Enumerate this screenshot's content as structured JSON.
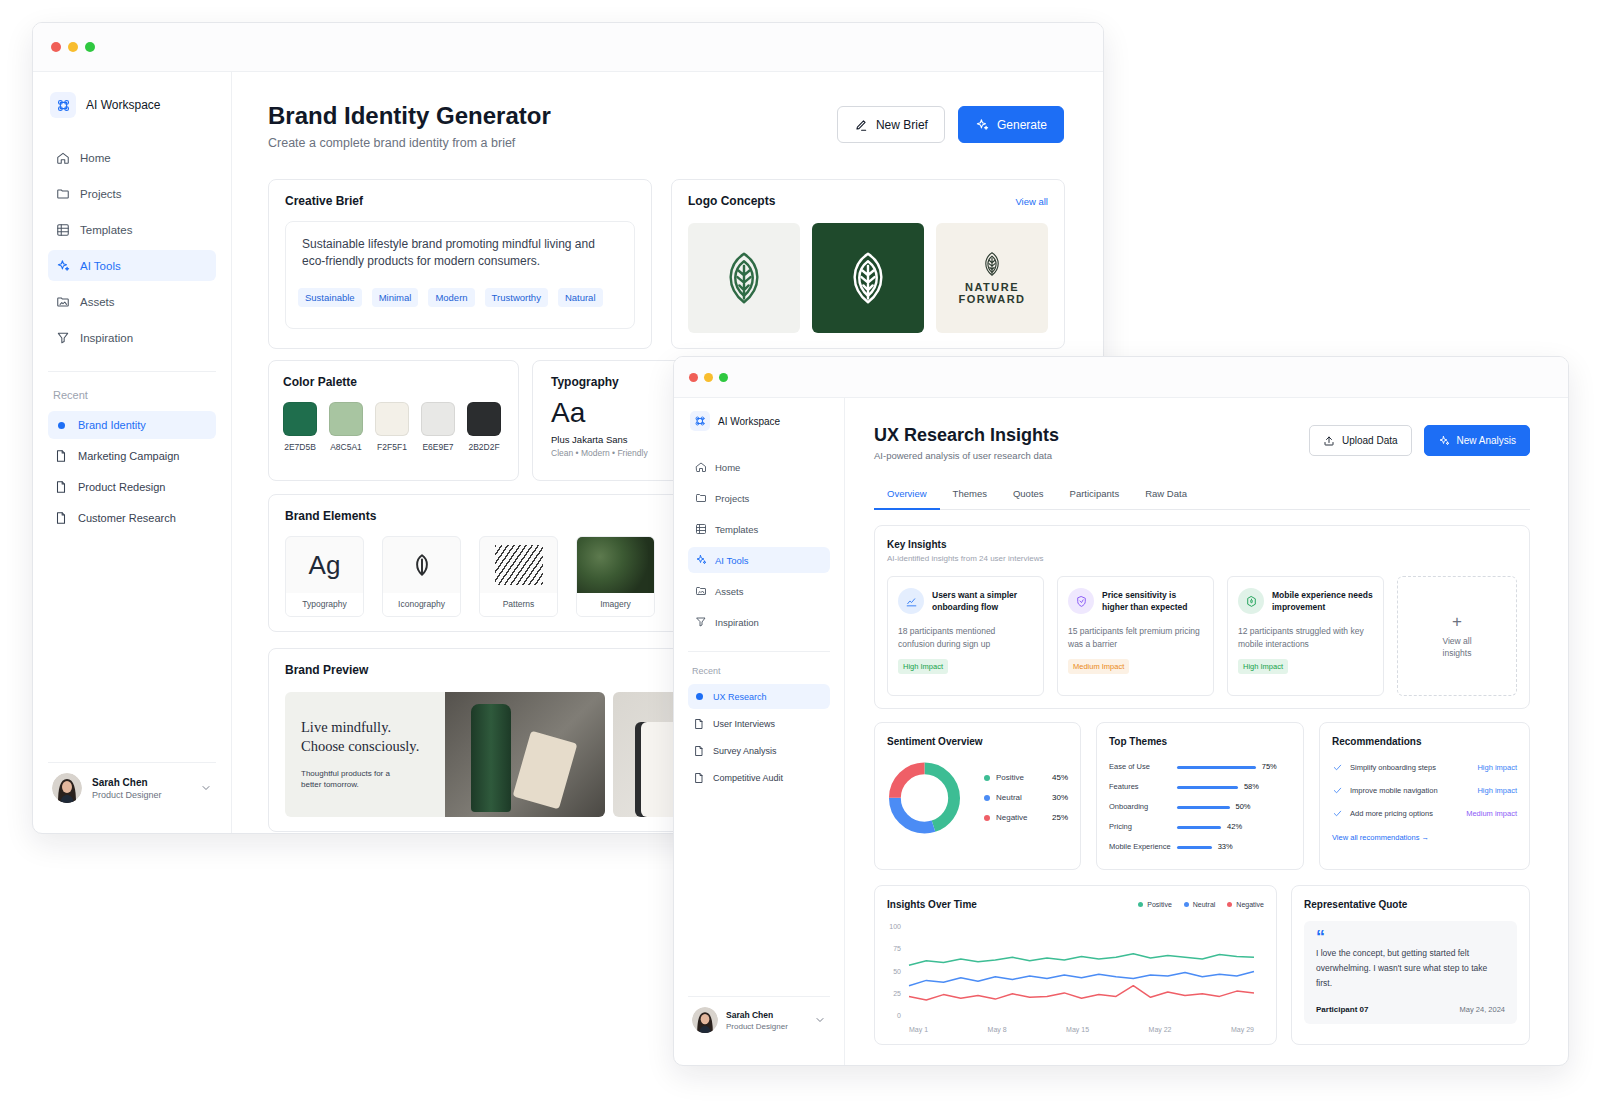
{
  "brand_window": {
    "sidebar": {
      "workspace": "AI Workspace",
      "nav": [
        {
          "label": "Home",
          "selected": false
        },
        {
          "label": "Projects",
          "selected": false
        },
        {
          "label": "Templates",
          "selected": false
        },
        {
          "label": "AI Tools",
          "selected": true
        },
        {
          "label": "Assets",
          "selected": false
        },
        {
          "label": "Inspiration",
          "selected": false
        }
      ],
      "recent_heading": "Recent",
      "recent": [
        {
          "label": "Brand Identity",
          "selected": true
        },
        {
          "label": "Marketing Campaign",
          "selected": false
        },
        {
          "label": "Product Redesign",
          "selected": false
        },
        {
          "label": "Customer Research",
          "selected": false
        }
      ],
      "user": {
        "name": "Sarah Chen",
        "role": "Product Designer"
      }
    },
    "header": {
      "title": "Brand Identity Generator",
      "subtitle": "Create a complete brand identity from a brief",
      "buttons": [
        {
          "label": "New Brief",
          "kind": "secondary"
        },
        {
          "label": "Generate",
          "kind": "primary"
        }
      ]
    },
    "creative_brief": {
      "title": "Creative Brief",
      "text": "Sustainable lifestyle brand promoting mindful living and eco-friendly products for modern consumers.",
      "tags": [
        "Sustainable",
        "Minimal",
        "Modern",
        "Trustworthy",
        "Natural"
      ]
    },
    "logo_concepts": {
      "title": "Logo Concepts",
      "link": "View all",
      "concepts": [
        {
          "kind": "mark",
          "color": "#f1f2ef",
          "ink": "#2f6b45"
        },
        {
          "kind": "mark",
          "color": "#1f4a2c",
          "ink": "#ffffff"
        },
        {
          "kind": "wordmark",
          "color": "#f4f1ea",
          "ink": "#2b3a2f",
          "lines": [
            "NATURE",
            "FORWARD"
          ]
        }
      ]
    },
    "color_palette": {
      "title": "Color Palette",
      "swatches": [
        {
          "label": "2E7D5B",
          "color": "#1f6e4d"
        },
        {
          "label": "A8C5A1",
          "color": "#a8c5a1"
        },
        {
          "label": "F2F5F1",
          "color": "#f3f0e8"
        },
        {
          "label": "E6E9E7",
          "color": "#e8e8e6"
        },
        {
          "label": "2B2D2F",
          "color": "#2b2d2f"
        }
      ]
    },
    "typography": {
      "title": "Typography",
      "sample": "Aa",
      "font": "Plus Jakarta Sans",
      "traits": "Clean • Modern • Friendly"
    },
    "brand_elements": {
      "title": "Brand Elements",
      "items": [
        {
          "kind": "type",
          "glyph": "Ag",
          "label": "Typography"
        },
        {
          "kind": "icon",
          "label": "Iconography"
        },
        {
          "kind": "pattern",
          "label": "Patterns"
        },
        {
          "kind": "image",
          "label": "Imagery"
        }
      ]
    },
    "brand_preview": {
      "title": "Brand Preview",
      "headline": [
        "Live mindfully.",
        "Choose consciously."
      ],
      "body": "Thoughtful products for a better tomorrow."
    }
  },
  "research_window": {
    "sidebar": {
      "workspace": "AI Workspace",
      "nav": [
        {
          "label": "Home",
          "selected": false
        },
        {
          "label": "Projects",
          "selected": false
        },
        {
          "label": "Templates",
          "selected": false
        },
        {
          "label": "AI Tools",
          "selected": true
        },
        {
          "label": "Assets",
          "selected": false
        },
        {
          "label": "Inspiration",
          "selected": false
        }
      ],
      "recent_heading": "Recent",
      "recent": [
        {
          "label": "UX Research",
          "selected": true
        },
        {
          "label": "User Interviews",
          "selected": false
        },
        {
          "label": "Survey Analysis",
          "selected": false
        },
        {
          "label": "Competitive Audit",
          "selected": false
        }
      ],
      "user": {
        "name": "Sarah Chen",
        "role": "Product Designer"
      }
    },
    "header": {
      "title": "UX Research Insights",
      "subtitle": "AI-powered analysis of user research data",
      "buttons": [
        {
          "label": "Upload Data",
          "kind": "secondary"
        },
        {
          "label": "New Analysis",
          "kind": "primary"
        }
      ]
    },
    "tabs": [
      {
        "label": "Overview",
        "selected": true
      },
      {
        "label": "Themes",
        "selected": false
      },
      {
        "label": "Quotes",
        "selected": false
      },
      {
        "label": "Participants",
        "selected": false
      },
      {
        "label": "Raw Data",
        "selected": false
      }
    ],
    "key_insights": {
      "title": "Key Insights",
      "subtitle": "AI-identified insights from 24 user interviews",
      "insights": [
        {
          "title": "Users want a simpler onboarding flow",
          "detail": "18 participants mentioned confusion during sign up",
          "impact": "High Impact",
          "color": "#3b82f6",
          "impact_color": "#16a34a"
        },
        {
          "title": "Price sensitivity is higher than expected",
          "detail": "15 participants felt premium pricing was a barrier",
          "impact": "Medium Impact",
          "color": "#8b5cf6",
          "impact_color": "#ea8a1a"
        },
        {
          "title": "Mobile experience needs improvement",
          "detail": "12 participants struggled with key mobile interactions",
          "impact": "High Impact",
          "color": "#22a35a",
          "impact_color": "#16a34a"
        }
      ],
      "add": {
        "icon": "+",
        "label": "View all insights"
      }
    },
    "sentiment": {
      "title": "Sentiment Overview",
      "segments": [
        {
          "label": "Positive",
          "value": "45%",
          "share": 0.45,
          "color": "#3dbd94"
        },
        {
          "label": "Neutral",
          "value": "30%",
          "share": 0.3,
          "color": "#4b8cf5"
        },
        {
          "label": "Negative",
          "value": "25%",
          "share": 0.25,
          "color": "#ef5f67"
        }
      ]
    },
    "top_themes": {
      "title": "Top Themes",
      "themes": [
        {
          "label": "Ease of Use",
          "value": "75%",
          "level": 0.75
        },
        {
          "label": "Features",
          "value": "58%",
          "level": 0.58
        },
        {
          "label": "Onboarding",
          "value": "50%",
          "level": 0.5
        },
        {
          "label": "Pricing",
          "value": "42%",
          "level": 0.42
        },
        {
          "label": "Mobile Experience",
          "value": "33%",
          "level": 0.33
        }
      ]
    },
    "recommendations": {
      "title": "Recommendations",
      "items": [
        {
          "text": "Simplify onboarding steps",
          "impact": "High impact",
          "impact_color": "#3b82f6"
        },
        {
          "text": "Improve mobile navigation",
          "impact": "High impact",
          "impact_color": "#3b82f6"
        },
        {
          "text": "Add more pricing options",
          "impact": "Medium impact",
          "impact_color": "#8b5cf6"
        }
      ],
      "link": "View all recommendations",
      "link_icon": "→"
    },
    "insights_over_time": {
      "title": "Insights Over Time",
      "y_ticks": [
        "100",
        "75",
        "50",
        "25",
        "0"
      ],
      "x_ticks": [
        "May 1",
        "May 8",
        "May 15",
        "May 22",
        "May 29"
      ],
      "series": [
        {
          "label": "Positive",
          "color": "#3dbd94",
          "values": [
            57,
            62,
            60,
            64,
            61,
            63,
            66,
            62,
            65,
            63,
            67,
            64,
            66,
            70,
            65,
            68,
            66,
            64,
            69,
            67,
            66
          ]
        },
        {
          "label": "Neutral",
          "color": "#4b8cf5",
          "values": [
            34,
            40,
            38,
            43,
            39,
            44,
            41,
            45,
            42,
            46,
            43,
            47,
            44,
            42,
            46,
            45,
            49,
            44,
            47,
            45,
            50
          ]
        },
        {
          "label": "Negative",
          "color": "#ef5f67",
          "values": [
            22,
            18,
            24,
            20,
            23,
            19,
            25,
            21,
            22,
            26,
            20,
            24,
            22,
            34,
            21,
            27,
            23,
            25,
            22,
            28,
            26
          ]
        }
      ]
    },
    "quote": {
      "title": "Representative Quote",
      "mark": "“",
      "text": "I love the concept, but getting started felt overwhelming. I wasn't sure what step to take first.",
      "participant": "Participant 07",
      "date": "May 24, 2024"
    }
  }
}
